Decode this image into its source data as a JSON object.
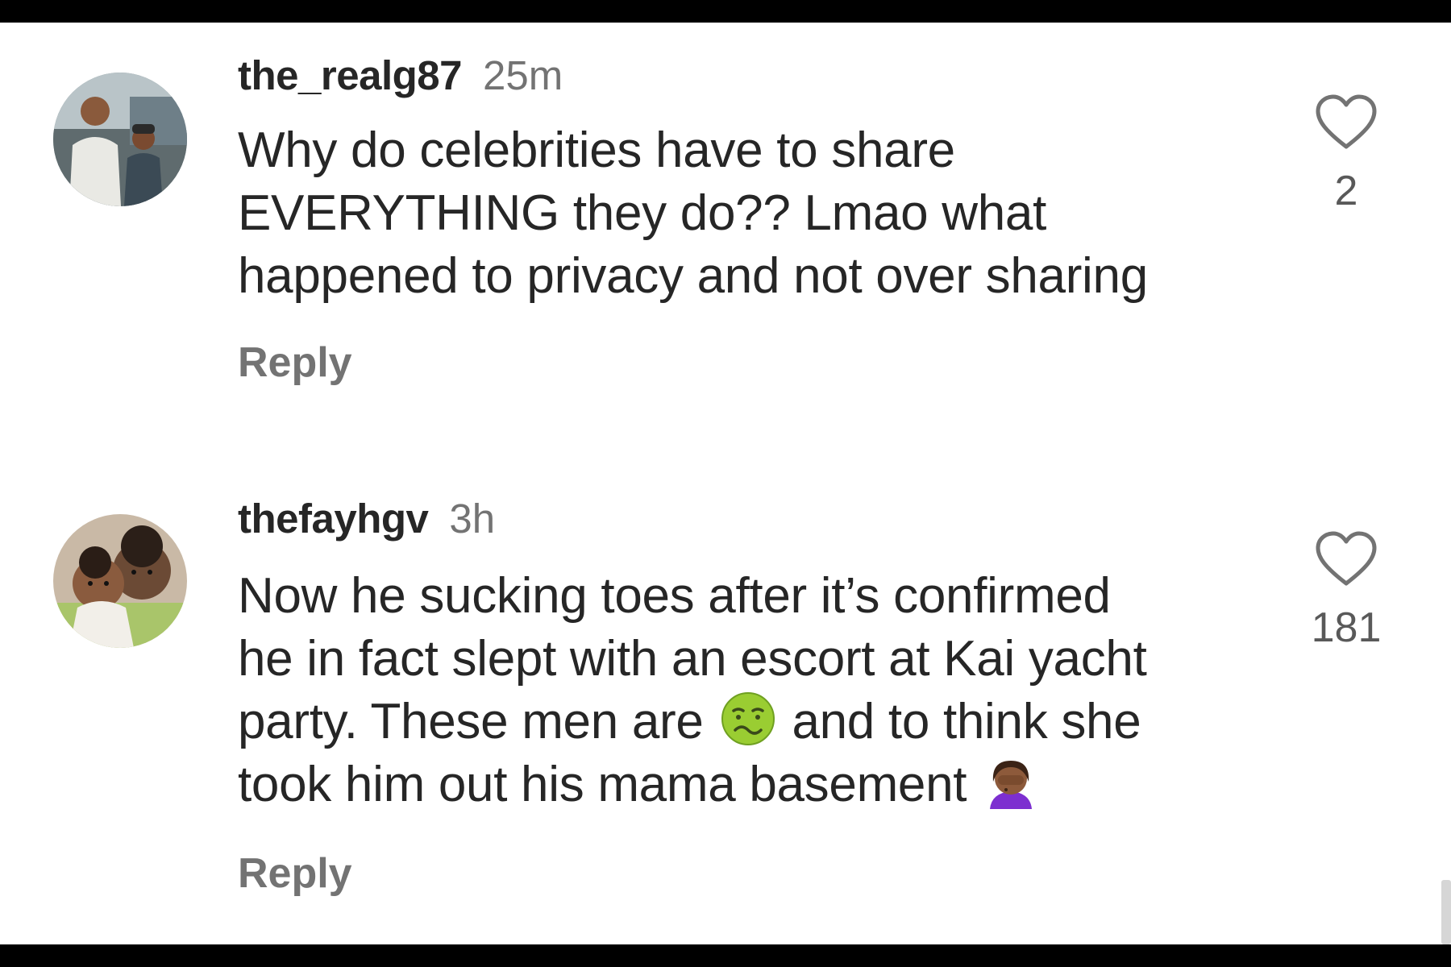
{
  "comments": [
    {
      "username": "the_realg87",
      "time": "25m",
      "text_lines": [
        "Why do celebrities have to share",
        "EVERYTHING they do?? Lmao what",
        "happened to privacy and not over sharing"
      ],
      "reply_label": "Reply",
      "like_count": "2",
      "avatar_icon": "user-photo-two-people",
      "like_icon": "heart-outline-icon"
    },
    {
      "username": "thefayhgv",
      "time": "3h",
      "text_lines": [
        "Now he sucking toes after it’s confirmed",
        "he in fact slept with an escort at Kai yacht"
      ],
      "line3_before": "party. These men are",
      "line3_emoji": "nauseated-face-emoji",
      "line3_after": "and to think she",
      "line4_text": "took him out his mama basement",
      "line4_emoji": "woman-facepalming-emoji",
      "reply_label": "Reply",
      "like_count": "181",
      "avatar_icon": "user-photo-two-children",
      "like_icon": "heart-outline-icon"
    }
  ],
  "colors": {
    "background": "#ffffff",
    "frame": "#000000",
    "text_primary": "#262626",
    "text_secondary": "#737373",
    "emoji_green": "#9acd32"
  }
}
